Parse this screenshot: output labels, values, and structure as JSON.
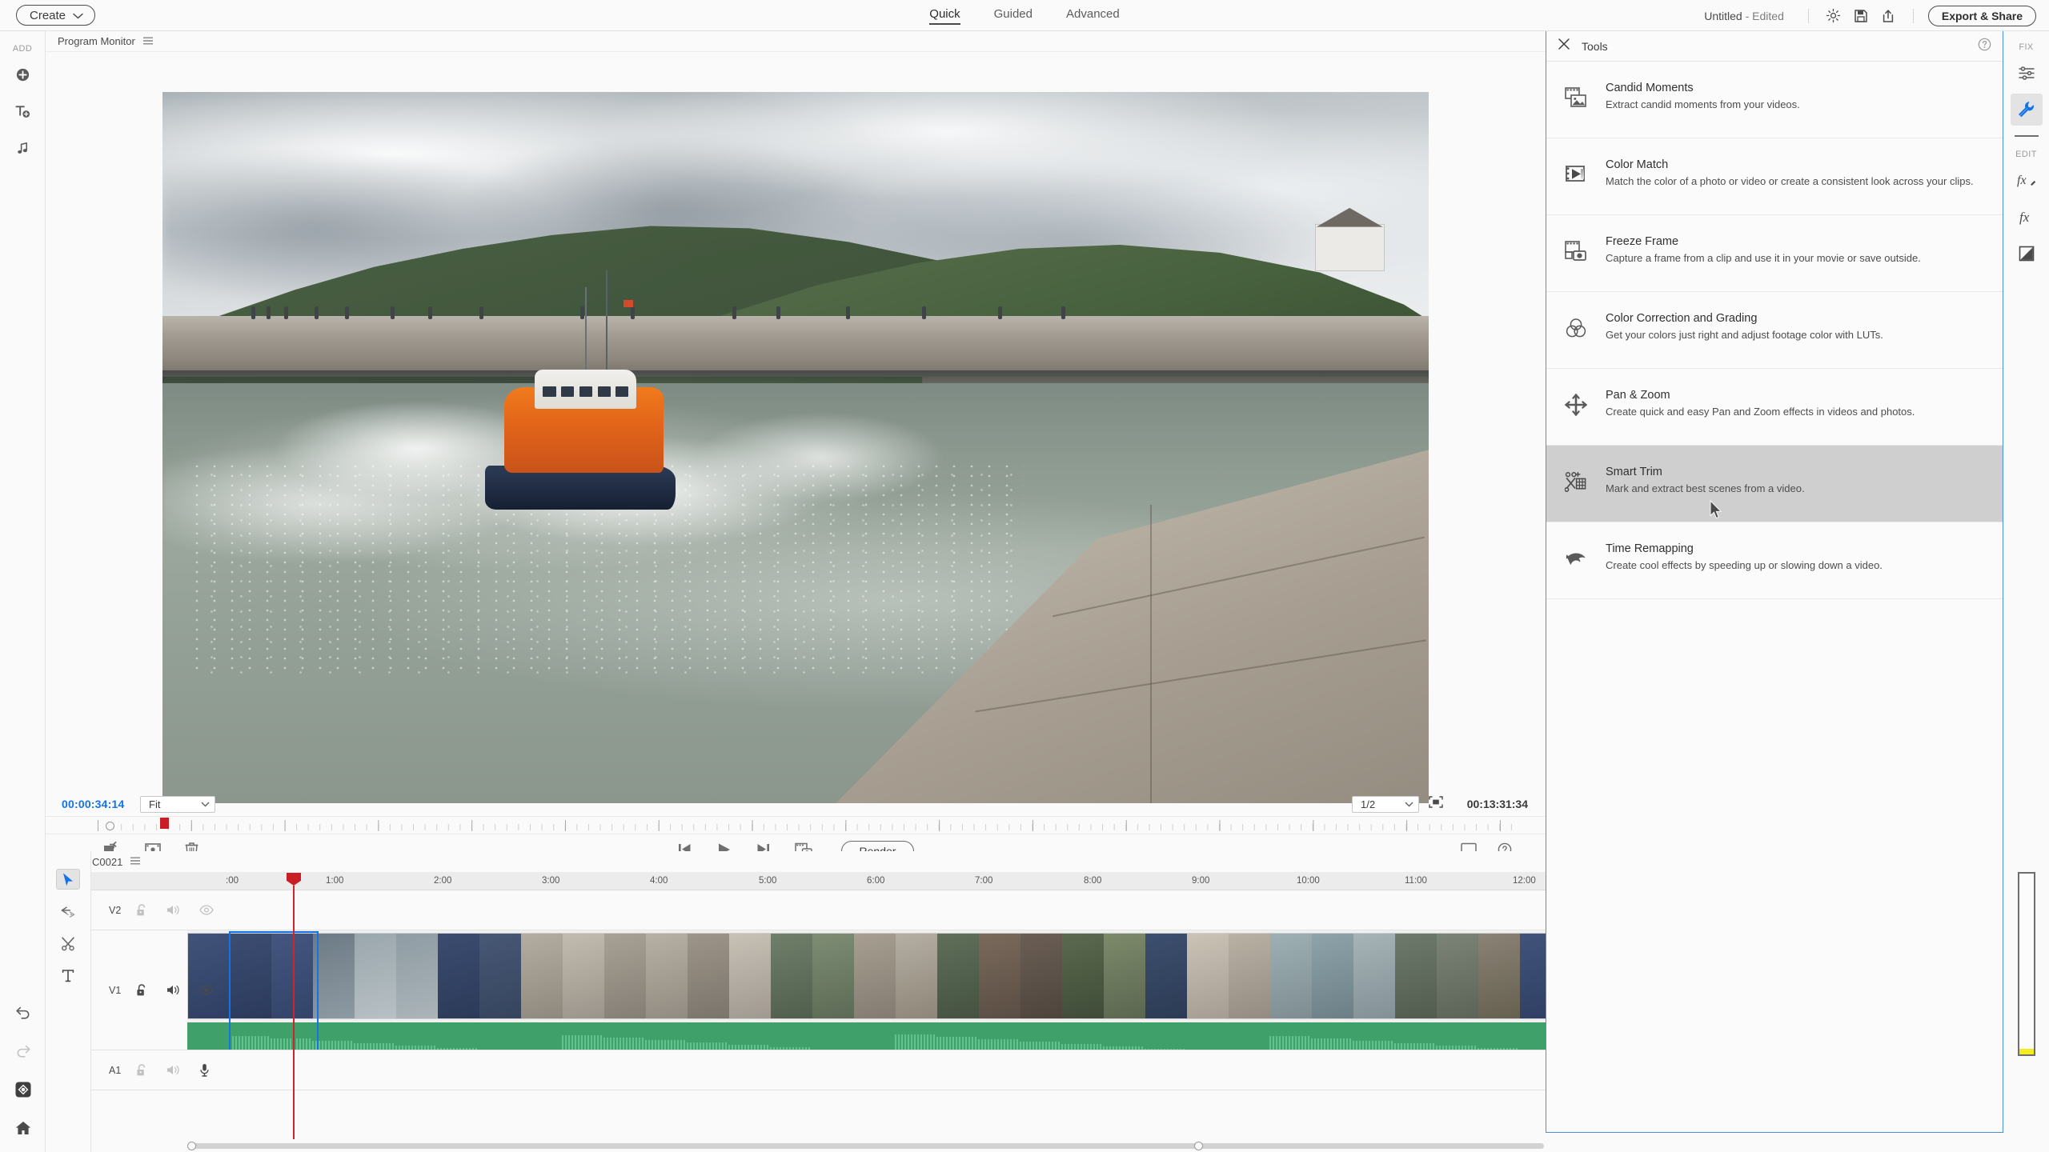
{
  "app": {
    "create_button": "Create",
    "document_title": "Untitled",
    "document_state": "- Edited",
    "export_button": "Export & Share"
  },
  "mode_tabs": [
    {
      "label": "Quick",
      "active": true
    },
    {
      "label": "Guided",
      "active": false
    },
    {
      "label": "Advanced",
      "active": false
    }
  ],
  "topbar_icons": [
    {
      "name": "brightness-icon"
    },
    {
      "name": "save-icon"
    },
    {
      "name": "share-icon"
    }
  ],
  "left_rail": {
    "section_label": "ADD",
    "items": [
      {
        "name": "add-media-icon",
        "label": "Add Media"
      },
      {
        "name": "add-title-icon",
        "label": "Add Title"
      },
      {
        "name": "add-music-icon",
        "label": "Add Music"
      }
    ],
    "bottom_items": [
      {
        "name": "undo-icon",
        "label": "Undo",
        "enabled": true
      },
      {
        "name": "redo-icon",
        "label": "Redo",
        "enabled": false
      },
      {
        "name": "organizer-icon",
        "label": "Organizer",
        "enabled": true
      },
      {
        "name": "home-icon",
        "label": "Home",
        "enabled": true
      }
    ]
  },
  "monitor": {
    "title": "Program Monitor",
    "current_timecode": "00:00:34:14",
    "total_timecode": "00:13:31:34",
    "zoom_level": "Fit",
    "playback_resolution": "1/2",
    "render_button": "Render",
    "left_tools": [
      {
        "name": "rotate-icon"
      },
      {
        "name": "freeze-frame-icon"
      },
      {
        "name": "delete-icon"
      }
    ],
    "transport": [
      {
        "name": "step-back-icon"
      },
      {
        "name": "play-icon"
      },
      {
        "name": "step-forward-icon"
      },
      {
        "name": "frame-capture-icon"
      }
    ],
    "right_tools": [
      {
        "name": "display-icon"
      },
      {
        "name": "help-icon"
      }
    ]
  },
  "timeline": {
    "title": "C0021",
    "tools": [
      {
        "name": "selection-tool-icon",
        "active": true
      },
      {
        "name": "trim-tool-icon",
        "active": false
      },
      {
        "name": "razor-tool-icon",
        "active": false
      },
      {
        "name": "text-tool-icon",
        "active": false
      }
    ],
    "ruler_labels": [
      ":00",
      "1:00",
      "2:00",
      "3:00",
      "4:00",
      "5:00",
      "6:00",
      "7:00",
      "8:00",
      "9:00",
      "10:00",
      "11:00",
      "12:00"
    ],
    "tracks": [
      {
        "name": "V2",
        "type": "video",
        "lock": "unlocked",
        "audio": "on",
        "visibility": "visible"
      },
      {
        "name": "V1",
        "type": "video",
        "lock": "unlocked",
        "audio": "on",
        "visibility": "visible"
      },
      {
        "name": "A1",
        "type": "audio",
        "lock": "unlocked",
        "audio": "on",
        "visibility": "mic"
      }
    ]
  },
  "tools_panel": {
    "title": "Tools",
    "close_icon": "close-icon",
    "help_icon": "help-icon",
    "items": [
      {
        "icon": "candid-moments-icon",
        "name": "Candid Moments",
        "description": "Extract candid moments from your videos.",
        "selected": false
      },
      {
        "icon": "color-match-icon",
        "name": "Color Match",
        "description": "Match the color of a photo or video or create a consistent look across your clips.",
        "selected": false
      },
      {
        "icon": "freeze-frame-icon",
        "name": "Freeze Frame",
        "description": "Capture a frame from a clip and use it in your movie or save outside.",
        "selected": false
      },
      {
        "icon": "color-correction-icon",
        "name": "Color Correction and Grading",
        "description": "Get your colors just right and adjust footage color with LUTs.",
        "selected": false
      },
      {
        "icon": "pan-zoom-icon",
        "name": "Pan & Zoom",
        "description": "Create quick and easy Pan and Zoom effects in videos and photos.",
        "selected": false
      },
      {
        "icon": "smart-trim-icon",
        "name": "Smart Trim",
        "description": "Mark and extract best scenes from a video.",
        "selected": true
      },
      {
        "icon": "time-remapping-icon",
        "name": "Time Remapping",
        "description": "Create cool effects by speeding up or slowing down a video.",
        "selected": false
      }
    ]
  },
  "right_rail": {
    "fix_label": "FIX",
    "edit_label": "EDIT",
    "fix_items": [
      {
        "name": "adjustments-icon",
        "active": false
      },
      {
        "name": "tools-icon",
        "active": true
      }
    ],
    "edit_items": [
      {
        "name": "effects-icon",
        "active": false
      },
      {
        "name": "fx-icon",
        "active": false
      },
      {
        "name": "transitions-icon",
        "active": false
      }
    ]
  },
  "colors": {
    "accent_blue": "#1473e6",
    "panel_border_blue": "#4a90e2",
    "playhead_red": "#c91f24",
    "audio_green": "#3fa06a",
    "selection_blue": "#1473e6",
    "selected_row_gray": "#cfcfcf",
    "slider_yellow": "#f3ec1f"
  }
}
